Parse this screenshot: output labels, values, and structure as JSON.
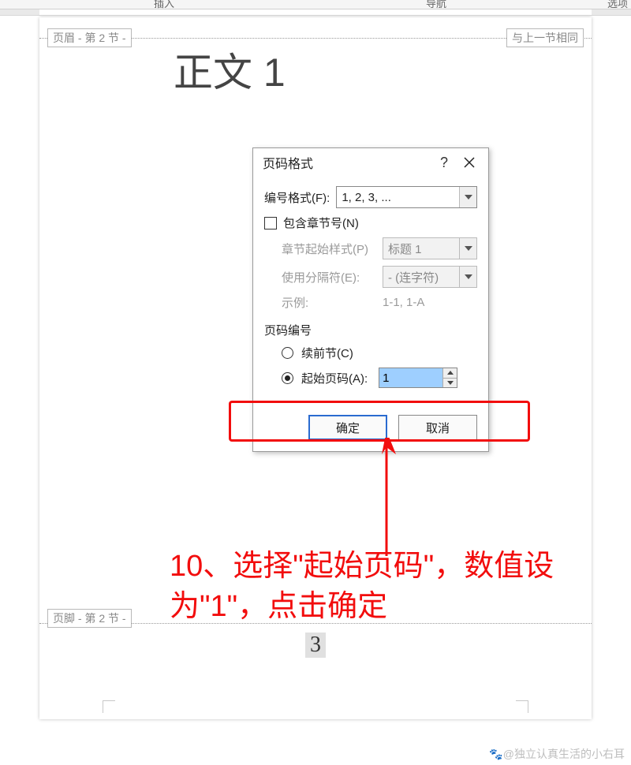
{
  "ribbon": {
    "insert": "插入",
    "nav": "导航",
    "options": "选项"
  },
  "tags": {
    "header": "页眉 - 第 2 节 -",
    "same_as_prev": "与上一节相同",
    "footer": "页脚 - 第 2 节 -"
  },
  "document": {
    "title": "正文 1",
    "footer_page_number": "3"
  },
  "dialog": {
    "title": "页码格式",
    "help": "?",
    "number_format_label": "编号格式(F):",
    "number_format_value": "1, 2, 3, ...",
    "include_chapter_label": "包含章节号(N)",
    "chapter_style_label": "章节起始样式(P)",
    "chapter_style_value": "标题 1",
    "separator_label": "使用分隔符(E):",
    "separator_value": "-  (连字符)",
    "example_label": "示例:",
    "example_value": "1-1, 1-A",
    "page_numbering_label": "页码编号",
    "continue_label": "续前节(C)",
    "start_at_label": "起始页码(A):",
    "start_at_value": "1",
    "ok": "确定",
    "cancel": "取消"
  },
  "annotation": {
    "text": "10、选择\"起始页码\"，数值设为\"1\"，点击确定"
  },
  "watermark": "@独立认真生活的小右耳"
}
